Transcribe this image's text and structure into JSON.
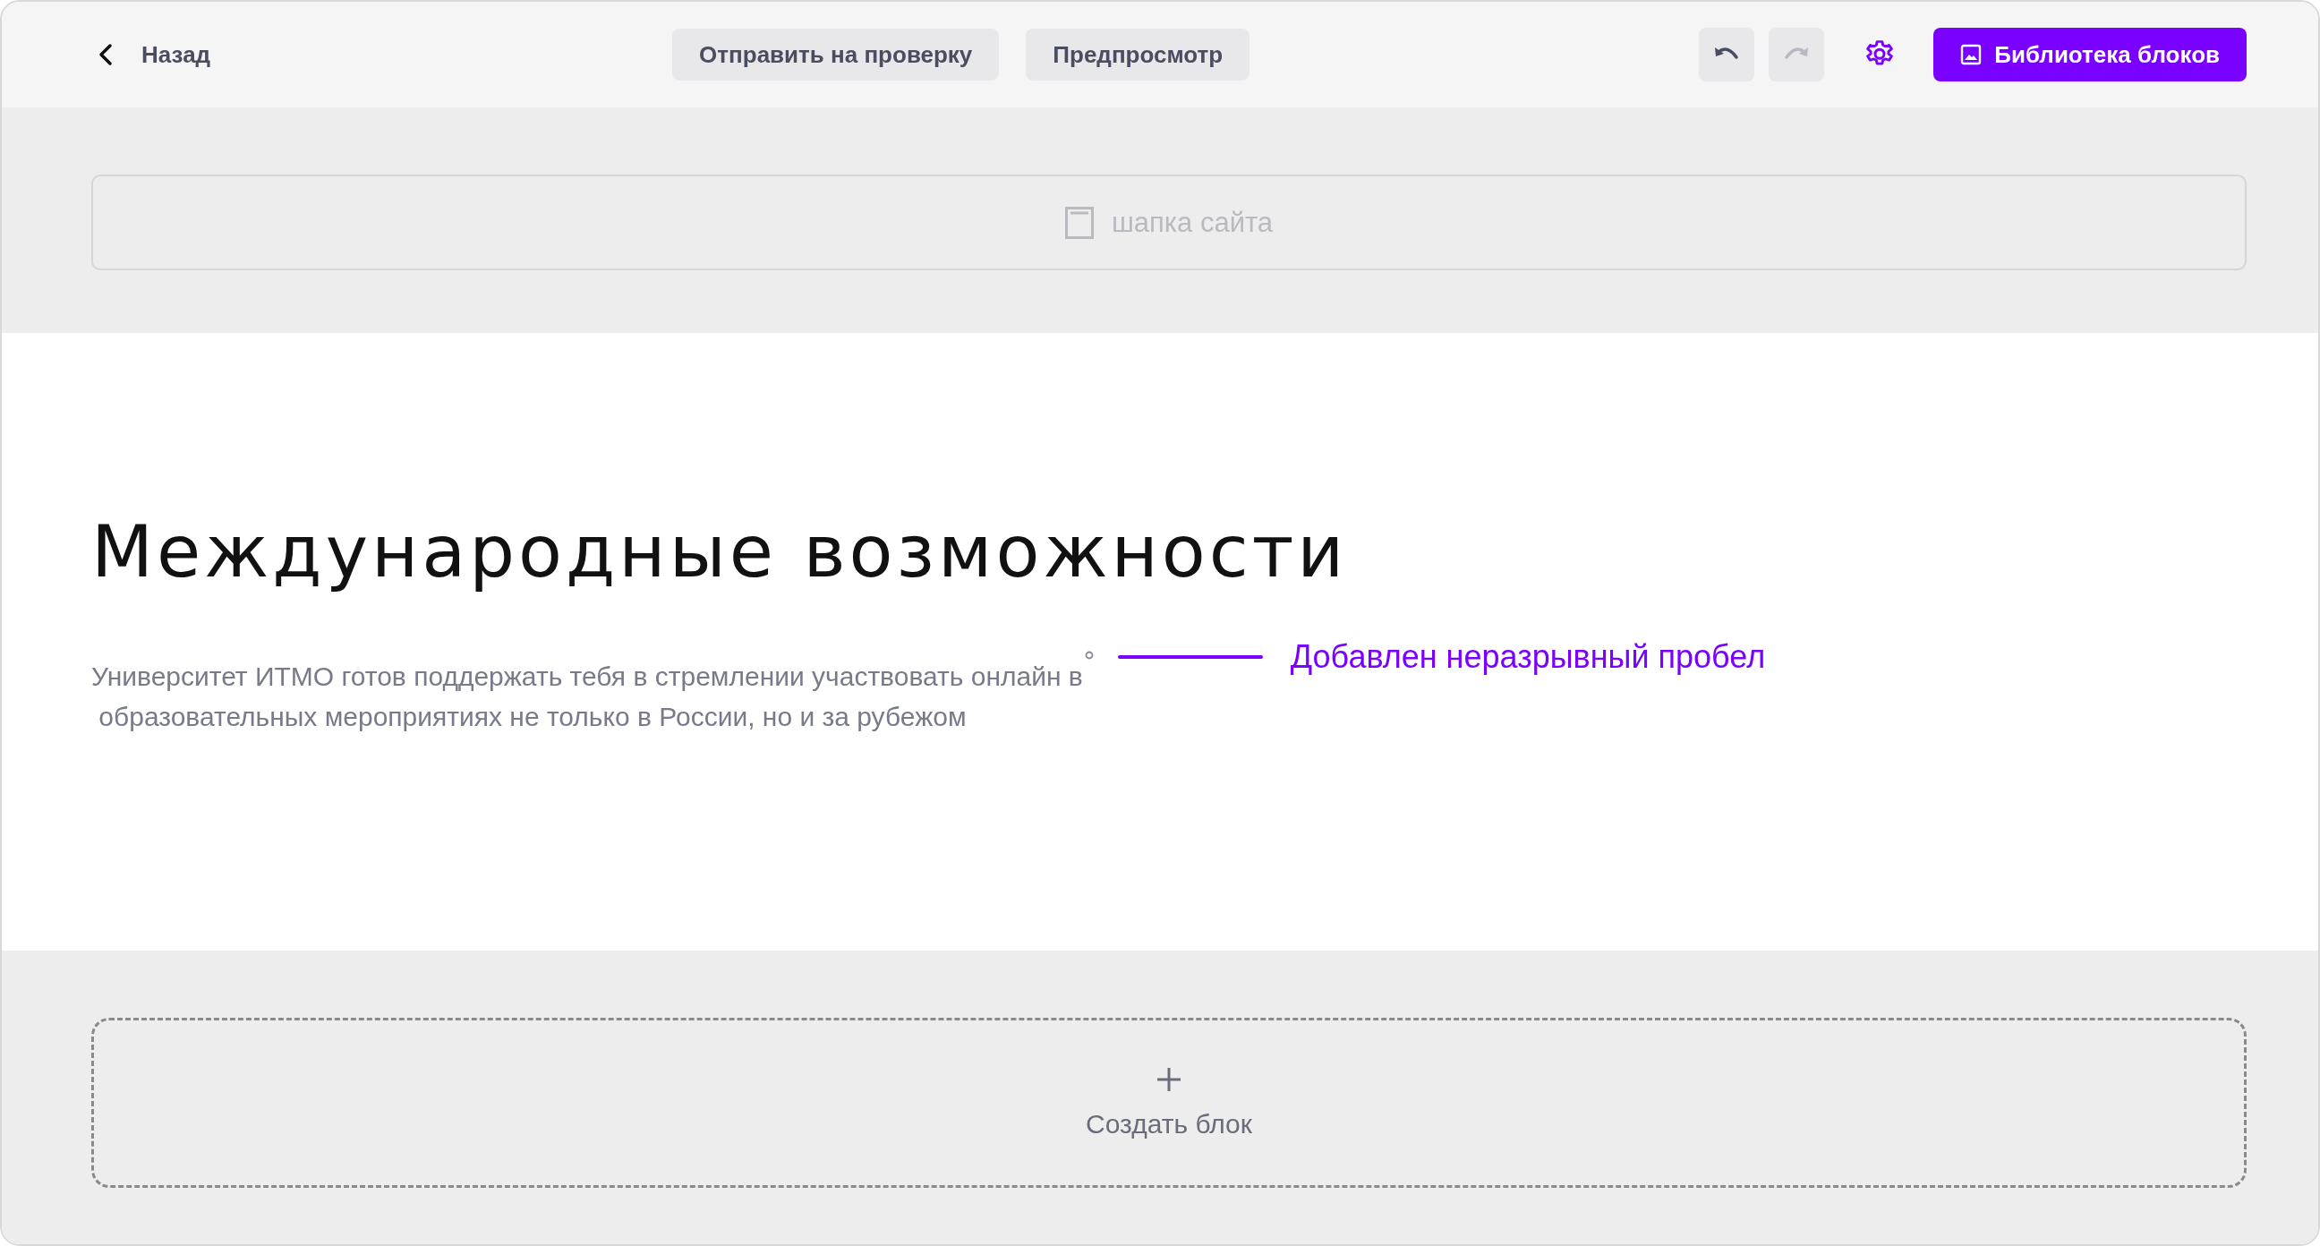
{
  "topbar": {
    "back": {
      "label": "Назад"
    },
    "actions": [
      {
        "label": "Отправить на проверку"
      },
      {
        "label": "Предпросмотр"
      }
    ],
    "history": [
      {
        "kind": "undo",
        "disabled": false
      },
      {
        "kind": "redo",
        "disabled": true
      }
    ],
    "library_button": {
      "label": "Библиотека блоков"
    }
  },
  "header_block": {
    "label": "шапка сайта"
  },
  "content": {
    "title": "Международные возможности",
    "paragraph_lines": [
      "Университет ИТМО готов поддержать тебя в стремлении участвовать онлайн в",
      "образовательных мероприятиях не только в России, но и за рубежом"
    ],
    "annotation": "Добавлен неразрывный пробел"
  },
  "create_block": {
    "label": "Создать блок"
  }
}
